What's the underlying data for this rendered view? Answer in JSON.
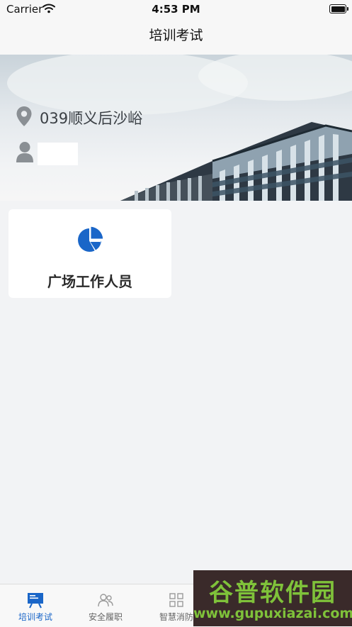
{
  "status_bar": {
    "carrier": "Carrier",
    "time": "4:53 PM"
  },
  "nav": {
    "title": "培训考试"
  },
  "banner": {
    "location": "039顺义后沙峪",
    "user_name": ""
  },
  "cards": [
    {
      "label": "广场工作人员",
      "icon": "pie-chart-icon"
    }
  ],
  "tabs": [
    {
      "label": "培训考试",
      "icon": "training-board-icon",
      "active": true
    },
    {
      "label": "安全履职",
      "icon": "users-icon",
      "active": false
    },
    {
      "label": "智慧消防",
      "icon": "grid-icon",
      "active": false
    }
  ],
  "watermark": {
    "title": "谷普软件园",
    "url": "www.gupuxiazai.com"
  },
  "colors": {
    "accent": "#1a66c8",
    "background": "#f2f3f5",
    "watermark_green": "#7fc23a"
  }
}
